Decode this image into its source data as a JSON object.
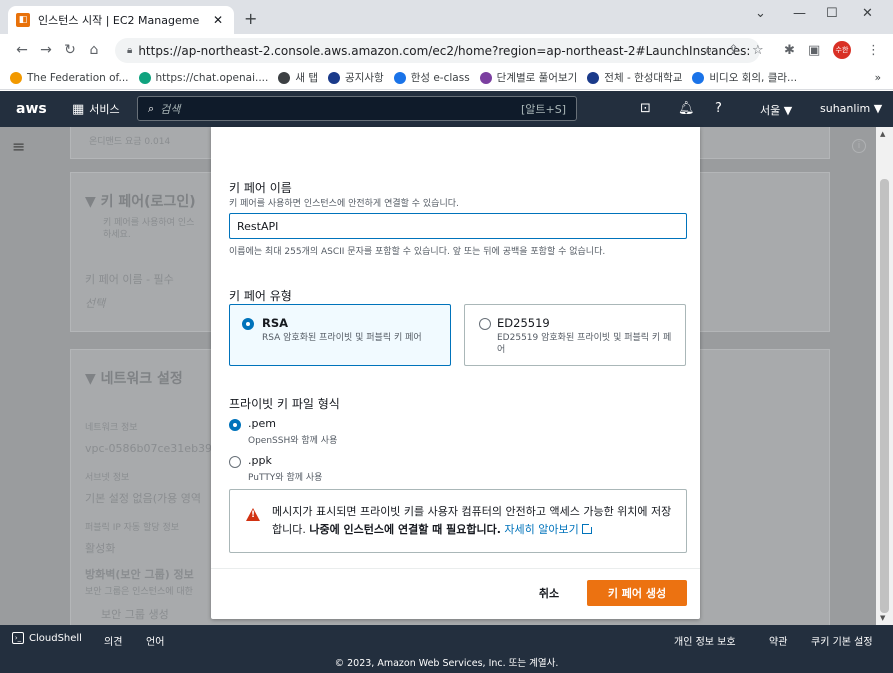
{
  "browser": {
    "tab_title": "인스턴스 시작 | EC2 Manageme",
    "tab_close": "✕",
    "new_tab": "+",
    "url": "https://ap-northeast-2.console.aws.amazon.com/ec2/home?region=ap-northeast-2#LaunchInstances:",
    "profile_label": "수한",
    "bookmarks": [
      {
        "label": "The Federation of...",
        "color": "#f29900"
      },
      {
        "label": "https://chat.openai....",
        "color": "#10a37f"
      },
      {
        "label": "새 탭",
        "color": "#3c4043"
      },
      {
        "label": "공지사항",
        "color": "#1a3a8a"
      },
      {
        "label": "한성 e-class",
        "color": "#1a73e8"
      },
      {
        "label": "단계별로 풀어보기",
        "color": "#7b3fa0"
      },
      {
        "label": "전체 - 한성대학교",
        "color": "#1a3a8a"
      },
      {
        "label": "비디오 회의, 클라...",
        "color": "#1a73e8"
      }
    ],
    "bookmarks_more": "»"
  },
  "aws_header": {
    "logo": "aws",
    "services_label": "서비스",
    "search_placeholder": "검색",
    "search_shortcut": "[알트+S]",
    "region": "서울 ▼",
    "user": "suhanlim ▼"
  },
  "background": {
    "top_snippet": "온디맨드 요금 0.014",
    "keypair_heading": "▼ 키 페어(로그인)",
    "keypair_desc1": "키 페어를 사용하여 인스",
    "keypair_desc2": "하세요.",
    "keypair_name_label": "키 페어 이름 - 필수",
    "keypair_select": "선택",
    "network_heading": "▼ 네트워크 설정",
    "network_label": "네트워크 정보",
    "vpc": "vpc-0586b07ce31eb39",
    "subnet_label": "서브넷 정보",
    "subnet_value": "기본 설정 없음(가용 영역",
    "public_ip_label": "퍼블릭 IP 자동 할당 정보",
    "public_ip_value": "활성화",
    "firewall_label": "방화벽(보안 그룹) 정보",
    "firewall_desc": "보안 그룹은 인스턴스에 대한",
    "create_sg": "보안 그룹 생성"
  },
  "modal": {
    "name_label": "키 페어 이름",
    "name_hint": "키 페어를 사용하면 인스턴스에 안전하게 연결할 수 있습니다.",
    "name_value": "RestAPI",
    "name_constraint": "이름에는 최대 255개의 ASCII 문자를 포함할 수 있습니다. 앞 또는 뒤에 공백을 포함할 수 없습니다.",
    "type_label": "키 페어 유형",
    "types": [
      {
        "label": "RSA",
        "desc": "RSA 암호화된 프라이빗 및 퍼블릭 키 페어",
        "selected": true
      },
      {
        "label": "ED25519",
        "desc": "ED25519 암호화된 프라이빗 및 퍼블릭 키 페어",
        "selected": false
      }
    ],
    "format_label": "프라이빗 키 파일 형식",
    "formats": [
      {
        "label": ".pem",
        "desc": "OpenSSH와 함께 사용",
        "selected": true
      },
      {
        "label": ".ppk",
        "desc": "PuTTY와 함께 사용",
        "selected": false
      }
    ],
    "alert_text": "메시지가 표시되면 프라이빗 키를 사용자 컴퓨터의 안전하고 액세스 가능한 위치에 저장합니다. ",
    "alert_bold": "나중에 인스턴스에 연결할 때 필요합니다.",
    "alert_link": "자세히 알아보기",
    "cancel": "취소",
    "create": "키 페어 생성"
  },
  "footer": {
    "cloudshell": "CloudShell",
    "feedback": "의견",
    "language": "언어",
    "privacy": "개인 정보 보호",
    "terms": "약관",
    "cookies": "쿠키 기본 설정",
    "copyright": "© 2023, Amazon Web Services, Inc. 또는 계열사."
  }
}
